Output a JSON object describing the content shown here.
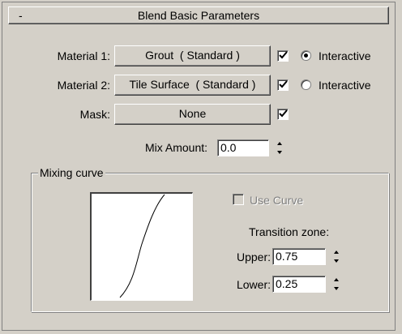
{
  "rollout": {
    "collapse_symbol": "-",
    "title": "Blend Basic Parameters"
  },
  "materials": [
    {
      "label": "Material 1:",
      "button": "Grout  ( Standard )",
      "enabled_checked": true,
      "interactive_selected": true,
      "interactive_label": "Interactive"
    },
    {
      "label": "Material 2:",
      "button": "Tile Surface  ( Standard )",
      "enabled_checked": true,
      "interactive_selected": false,
      "interactive_label": "Interactive"
    }
  ],
  "mask": {
    "label": "Mask:",
    "button": "None",
    "enabled_checked": true
  },
  "mix_amount": {
    "label": "Mix Amount:",
    "value": "0.0"
  },
  "mixing_curve": {
    "legend": "Mixing curve",
    "use_curve_label": "Use Curve",
    "use_curve_checked": false,
    "transition_zone_label": "Transition zone:",
    "upper_label": "Upper:",
    "upper_value": "0.75",
    "lower_label": "Lower:",
    "lower_value": "0.25"
  },
  "colors": {
    "panel_bg": "#d4d0c8",
    "field_bg": "#ffffff",
    "disabled_text": "#808080"
  }
}
